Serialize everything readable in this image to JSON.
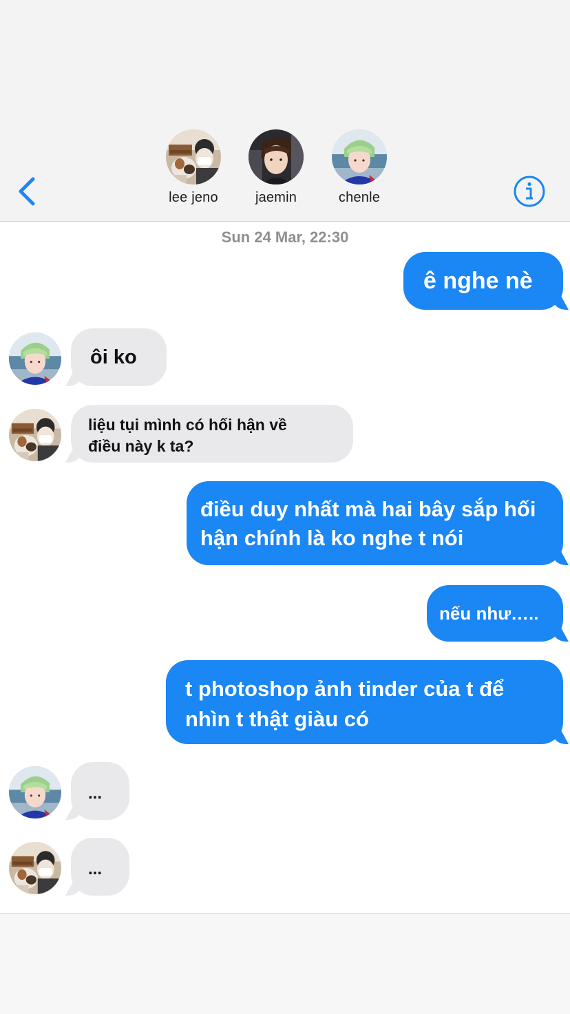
{
  "header": {
    "participants": [
      {
        "name": "lee jeno"
      },
      {
        "name": "jaemin"
      },
      {
        "name": "chenle"
      }
    ],
    "back_icon": "chevron-left-icon",
    "info_icon": "info-circle-icon",
    "accent_color": "#1a87f4"
  },
  "conversation": {
    "timestamp": "Sun 24 Mar, 22:30",
    "messages": [
      {
        "sender": "me",
        "text": "ê nghe nè"
      },
      {
        "sender": "chenle",
        "text": "ôi ko"
      },
      {
        "sender": "lee jeno",
        "lines": [
          "liệu tụi mình có hối hận về",
          "điều này k ta?"
        ]
      },
      {
        "sender": "me",
        "lines": [
          "điều duy nhất mà hai bây sắp hối",
          "hận chính là ko nghe t nói"
        ]
      },
      {
        "sender": "me",
        "text": "nếu như….."
      },
      {
        "sender": "me",
        "lines": [
          "t photoshop ảnh tinder của t để",
          "nhìn t thật giàu có"
        ]
      },
      {
        "sender": "chenle",
        "text": "..."
      },
      {
        "sender": "lee jeno",
        "text": "..."
      }
    ]
  }
}
